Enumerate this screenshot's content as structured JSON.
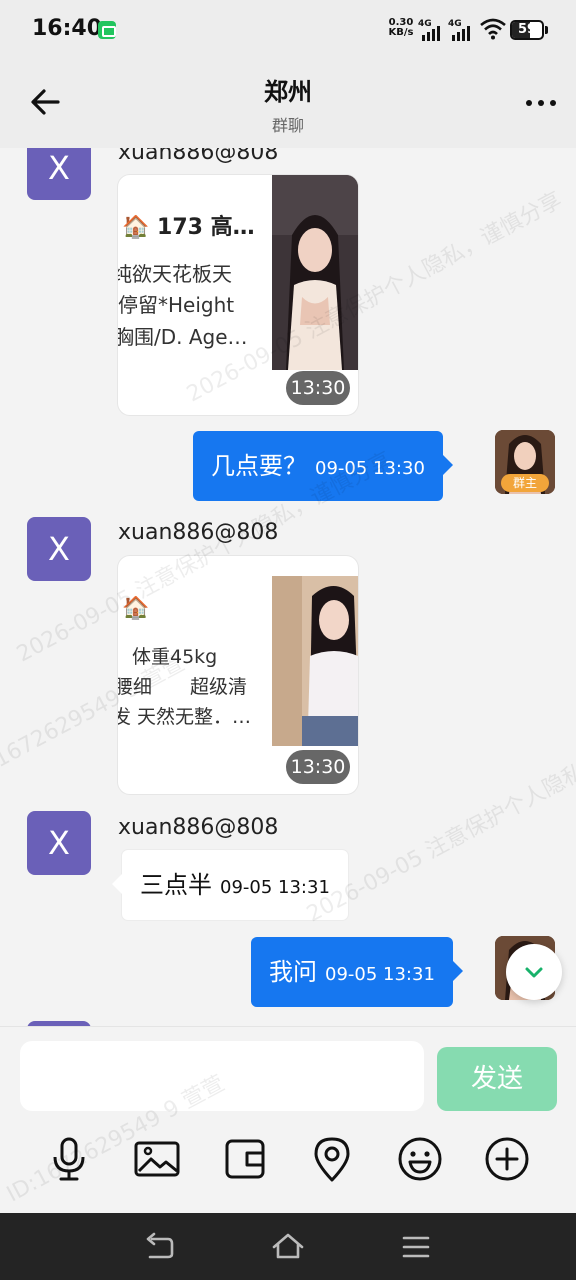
{
  "status_bar": {
    "time": "16:40",
    "net_speed_value": "0.30",
    "net_speed_unit": "KB/s",
    "signal_1": "4G",
    "signal_2": "4G",
    "battery": "59",
    "battery_level": 0.59
  },
  "header": {
    "title": "郑州",
    "subtitle": "群聊"
  },
  "messages": [
    {
      "type": "card",
      "side": "incoming",
      "avatar_letter": "X",
      "sender": "xuan886@808",
      "card_lines": [
        "🏠 173 高…",
        "纯欲天花板天",
        "停留*Height",
        "胸围/D. Age…"
      ],
      "time": "13:30"
    },
    {
      "type": "text",
      "side": "outgoing",
      "text": "几点要？",
      "time": "09-05 13:30",
      "avatar_badge": "群主"
    },
    {
      "type": "card",
      "side": "incoming",
      "avatar_letter": "X",
      "sender": "xuan886@808",
      "card_lines": [
        "🏠",
        "体重45kg",
        "腰细　　超级清",
        "发 天然无整．…"
      ],
      "time": "13:30"
    },
    {
      "type": "text",
      "side": "incoming",
      "avatar_letter": "X",
      "sender": "xuan886@808",
      "text": "三点半",
      "time": "09-05 13:31"
    },
    {
      "type": "text",
      "side": "outgoing",
      "text": "我问",
      "time": "09-05 13:31"
    }
  ],
  "watermark": {
    "line_1": "2026-09-05 注意保护个人隐私，谨慎分享",
    "line_2": "ID:1672629549 9 萱萱"
  },
  "composer": {
    "input_value": "",
    "send_label": "发送"
  },
  "colors": {
    "accent_blue": "#1677f0",
    "avatar_purple": "#6a60b8",
    "send_green": "#86dbb0",
    "owner_badge": "#f2a53a"
  },
  "icons": {
    "back": "arrow-left-icon",
    "more": "more-dots-icon",
    "tools": [
      "microphone-icon",
      "image-icon",
      "wallet-icon",
      "location-pin-icon",
      "emoji-icon",
      "add-circle-icon"
    ],
    "nav": [
      "nav-back-icon",
      "nav-home-icon",
      "nav-menu-icon"
    ]
  }
}
